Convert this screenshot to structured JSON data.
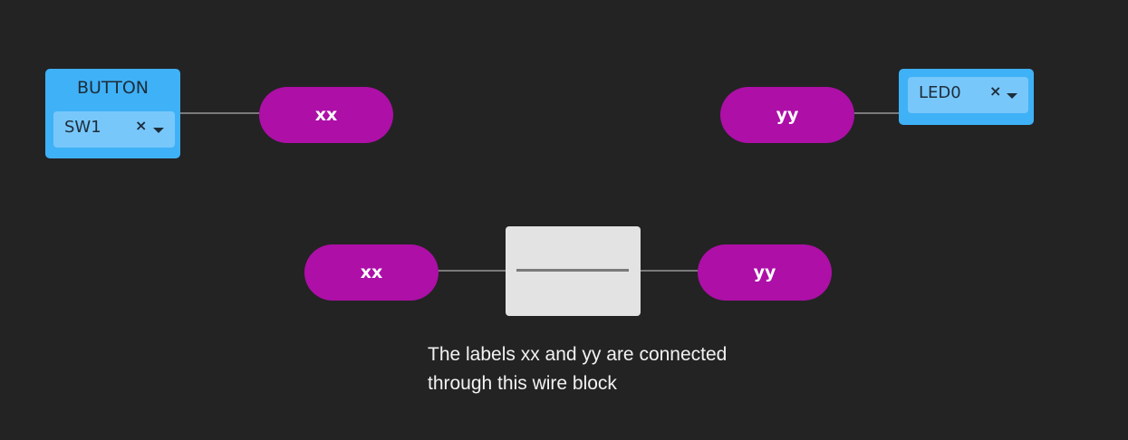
{
  "button_block": {
    "title": "BUTTON",
    "selected_value": "SW1",
    "clear_symbol": "×",
    "icons": [
      "close-icon",
      "chevron-down-icon"
    ]
  },
  "led_block": {
    "selected_value": "LED0",
    "clear_symbol": "×",
    "icons": [
      "close-icon",
      "chevron-down-icon"
    ]
  },
  "labels": {
    "top_left": "xx",
    "top_right": "yy",
    "wire_left": "xx",
    "wire_right": "yy"
  },
  "caption": {
    "line1": "The labels xx and yy are connected",
    "line2": "through this wire block"
  },
  "colors": {
    "background": "#232323",
    "io_block": "#3fb1f7",
    "io_select": "#78c7fb",
    "label_pill": "#ad0fa7",
    "wire": "#7a7a7a",
    "wire_block": "#e3e3e3"
  }
}
